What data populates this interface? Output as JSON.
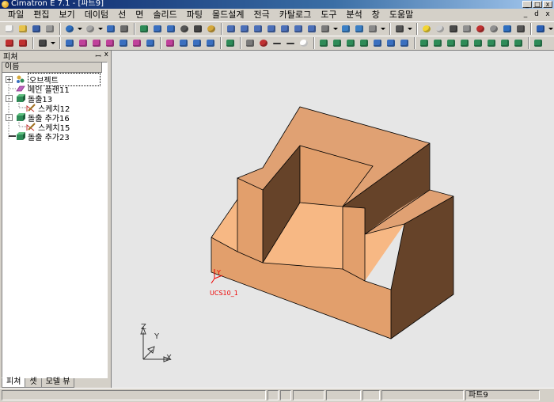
{
  "window": {
    "title": "Cimatron E 7.1 - [파트9]",
    "min_glyph": "_",
    "max_glyph": "□",
    "close_glyph": "x"
  },
  "menu": [
    "파일",
    "편집",
    "보기",
    "데이텀",
    "선",
    "면",
    "솔리드",
    "파팅",
    "몰드설계",
    "전극",
    "카탈로그",
    "도구",
    "분석",
    "창",
    "도움말"
  ],
  "mdi_buttons": [
    "_",
    "ⅾ",
    "x"
  ],
  "panel": {
    "title": "피쳐",
    "pin_glyph": "ꟷ",
    "close_glyph": "x",
    "column_header": "이름",
    "tabs": [
      "피쳐",
      "셋",
      "모델 뷰"
    ],
    "tree": [
      {
        "label": "오브젝트",
        "expander": "+",
        "icon": "objects-icon",
        "level": 0
      },
      {
        "label": "메인 플랜11",
        "expander": "",
        "icon": "plane-icon",
        "level": 0
      },
      {
        "label": "돌출13",
        "expander": "-",
        "icon": "extrude-icon",
        "level": 0
      },
      {
        "label": "스케치12",
        "expander": "",
        "icon": "sketch-icon",
        "level": 1
      },
      {
        "label": "돌출 추가16",
        "expander": "-",
        "icon": "extrude-icon",
        "level": 0
      },
      {
        "label": "스케치15",
        "expander": "",
        "icon": "sketch-icon",
        "level": 1
      },
      {
        "label": "돌출 추가23",
        "expander": "",
        "icon": "extrude-add-icon",
        "level": 0
      }
    ]
  },
  "viewport": {
    "ucs_label": "UCS10_1",
    "ucs_axis": "Y",
    "triad_labels": {
      "x": "X",
      "y": "Y",
      "z": "Z"
    },
    "colors": {
      "top": "#e0a173",
      "front": "#e29f6c",
      "side": "#664329",
      "inner_floor": "#f7b884",
      "background": "#e6e6e6"
    }
  },
  "status": {
    "part": "파트9"
  }
}
